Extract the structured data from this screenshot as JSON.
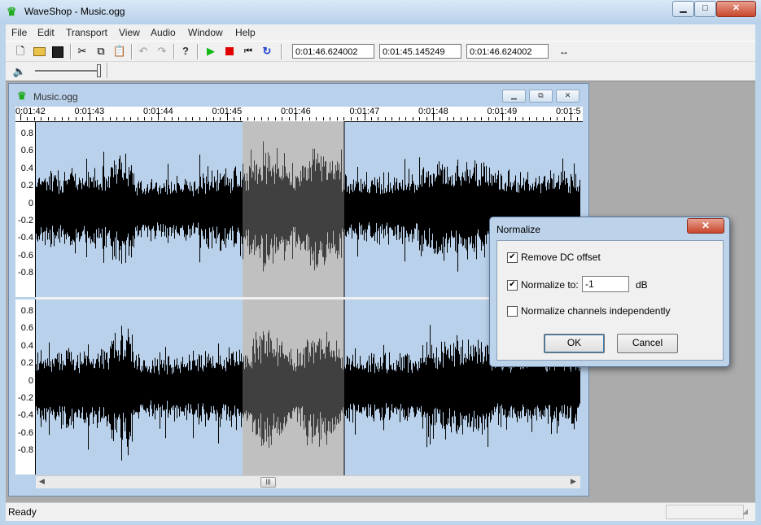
{
  "app": {
    "title": "WaveShop - Music.ogg",
    "caption_buttons": {
      "minimize": "▁",
      "maximize": "□",
      "close": "✕"
    }
  },
  "menu": [
    "File",
    "Edit",
    "Transport",
    "View",
    "Audio",
    "Window",
    "Help"
  ],
  "toolbar": {
    "icons": [
      "new-file-icon",
      "open-folder-icon",
      "save-icon",
      "cut-icon",
      "copy-icon",
      "paste-icon",
      "undo-icon",
      "redo-icon",
      "help-icon",
      "play-icon",
      "stop-icon",
      "rewind-icon",
      "loop-icon",
      "fit-icon"
    ],
    "time_fields": [
      "0:01:46.624002",
      "0:01:45.145249",
      "0:01:46.624002"
    ]
  },
  "volume": {
    "icon": "speaker-icon",
    "level": 0.95
  },
  "document": {
    "title": "Music.ogg",
    "ruler_labels": [
      "0:01:42",
      "0:01:43",
      "0:01:44",
      "0:01:45",
      "0:01:46",
      "0:01:47",
      "0:01:48",
      "0:01:49",
      "0:01:5"
    ],
    "channel_axis_labels": [
      "0.8",
      "0.6",
      "0.4",
      "0.2",
      "0",
      "-0.2",
      "-0.4",
      "-0.6",
      "-0.8"
    ],
    "selection": {
      "start": "0:01:45.145249",
      "end": "0:01:46.624002"
    }
  },
  "dialog": {
    "title": "Normalize",
    "close_label": "✕",
    "remove_dc": {
      "label": "Remove DC offset",
      "checked": true
    },
    "normalize_to": {
      "label": "Normalize to:",
      "checked": true,
      "value": "-1",
      "unit": "dB"
    },
    "independent": {
      "label": "Normalize channels independently",
      "checked": false
    },
    "ok": "OK",
    "cancel": "Cancel"
  },
  "status": {
    "text": "Ready"
  },
  "colors": {
    "selection": "#c0c0c0",
    "wave": "#000000",
    "wave_selected": "#404040"
  }
}
